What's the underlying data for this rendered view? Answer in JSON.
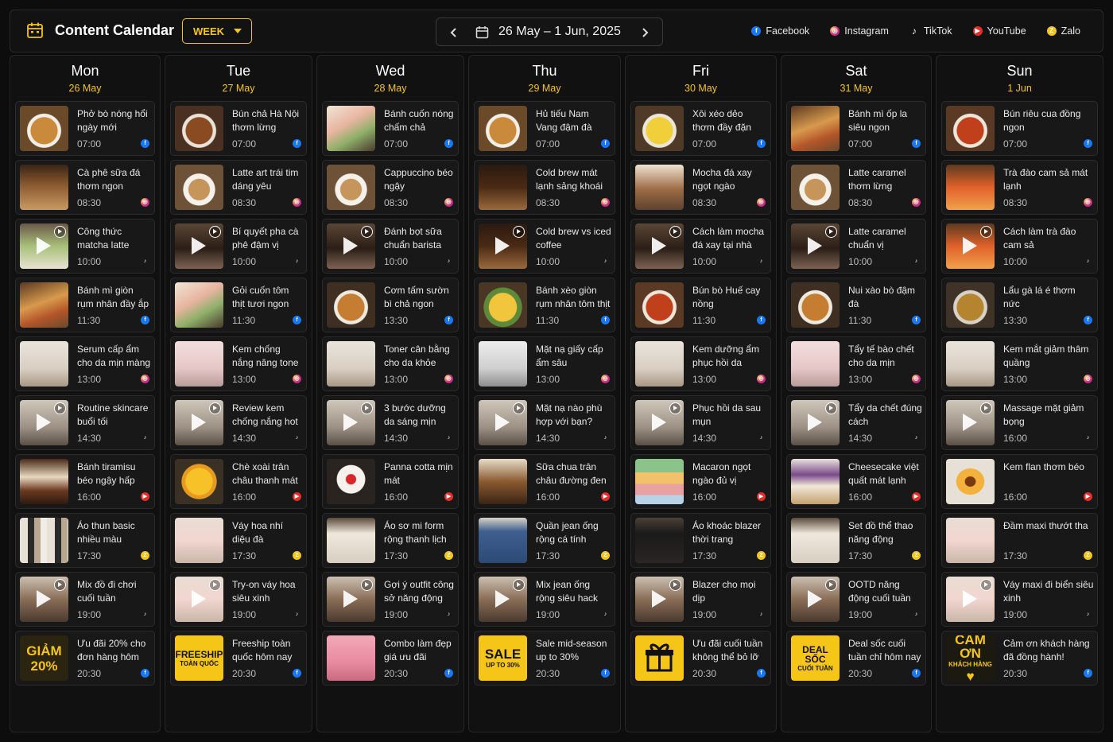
{
  "header": {
    "title": "Content Calendar",
    "view_label": "WEEK",
    "date_range": "26 May – 1 Jun, 2025",
    "prev_icon": "chevron-left-icon",
    "next_icon": "chevron-right-icon"
  },
  "platforms": [
    {
      "key": "fb",
      "label": "Facebook"
    },
    {
      "key": "ig",
      "label": "Instagram"
    },
    {
      "key": "tt",
      "label": "TikTok"
    },
    {
      "key": "yt",
      "label": "YouTube"
    },
    {
      "key": "za",
      "label": "Zalo"
    }
  ],
  "colors": {
    "accent": "#f5c518",
    "facebook": "#1877f2",
    "youtube": "#e52d27",
    "zalo": "#f5c518"
  },
  "days": [
    {
      "day": "Mon",
      "date": "26 May",
      "posts": [
        {
          "title": "Phở bò nóng hổi ngày mới",
          "time": "07:00",
          "platform": "fb",
          "thumb": "pho",
          "video": false
        },
        {
          "title": "Cà phê sữa đá thơm ngon",
          "time": "08:30",
          "platform": "ig",
          "thumb": "icecoffee",
          "video": false
        },
        {
          "title": "Công thức matcha latte chuẩn vị",
          "time": "10:00",
          "platform": "tt",
          "thumb": "matcha",
          "video": true
        },
        {
          "title": "Bánh mì giòn rụm nhân đầy ắp",
          "time": "11:30",
          "platform": "fb",
          "thumb": "banhmi",
          "video": false
        },
        {
          "title": "Serum cấp ẩm cho da mịn màng",
          "time": "13:00",
          "platform": "ig",
          "thumb": "serum",
          "video": false
        },
        {
          "title": "Routine skincare buổi tối",
          "time": "14:30",
          "platform": "tt",
          "thumb": "skincare",
          "video": true
        },
        {
          "title": "Bánh tiramisu béo ngậy hấp dẫn",
          "time": "16:00",
          "platform": "yt",
          "thumb": "dessert",
          "video": false
        },
        {
          "title": "Áo thun basic nhiều màu",
          "time": "17:30",
          "platform": "za",
          "thumb": "clothes",
          "video": false
        },
        {
          "title": "Mix đồ đi chơi cuối tuần",
          "time": "19:00",
          "platform": "tt",
          "thumb": "outfit",
          "video": true
        },
        {
          "title": "Ưu đãi 20% cho đơn hàng hôm nay",
          "time": "20:30",
          "platform": "fb",
          "thumb": "promo",
          "video": false,
          "promo": [
            "GIẢM",
            "20%"
          ],
          "promo_bg": "#2a2410",
          "promo_fg": "#f5c518"
        }
      ]
    },
    {
      "day": "Tue",
      "date": "27 May",
      "posts": [
        {
          "title": "Bún chả Hà Nội thơm lừng",
          "time": "07:00",
          "platform": "fb",
          "thumb": "bun",
          "video": false
        },
        {
          "title": "Latte art trái tim dáng yêu",
          "time": "08:30",
          "platform": "ig",
          "thumb": "latte",
          "video": false
        },
        {
          "title": "Bí quyết pha cà phê đậm vị",
          "time": "10:00",
          "platform": "tt",
          "thumb": "coffee",
          "video": true
        },
        {
          "title": "Gỏi cuốn tôm thịt tươi ngon",
          "time": "11:30",
          "platform": "fb",
          "thumb": "roll",
          "video": false
        },
        {
          "title": "Kem chống nắng nâng tone nhẹ",
          "time": "13:00",
          "platform": "ig",
          "thumb": "cream",
          "video": false
        },
        {
          "title": "Review kem chống nắng hot",
          "time": "14:30",
          "platform": "tt",
          "thumb": "skincare",
          "video": true
        },
        {
          "title": "Chè xoài trân châu thanh mát",
          "time": "16:00",
          "platform": "yt",
          "thumb": "mango",
          "video": false
        },
        {
          "title": "Váy hoa nhí diệu đà",
          "time": "17:30",
          "platform": "za",
          "thumb": "dress",
          "video": false
        },
        {
          "title": "Try-on váy hoa siêu xinh",
          "time": "19:00",
          "platform": "tt",
          "thumb": "dress",
          "video": true
        },
        {
          "title": "Freeship toàn quốc hôm nay",
          "time": "20:30",
          "platform": "fb",
          "thumb": "promo",
          "video": false,
          "promo": [
            "FREESHIP",
            "TOÀN QUỐC"
          ],
          "promo_bg": "#f5c518",
          "promo_fg": "#111"
        }
      ]
    },
    {
      "day": "Wed",
      "date": "28 May",
      "posts": [
        {
          "title": "Bánh cuốn nóng chấm chả",
          "time": "07:00",
          "platform": "fb",
          "thumb": "roll",
          "video": false
        },
        {
          "title": "Cappuccino béo ngậy",
          "time": "08:30",
          "platform": "ig",
          "thumb": "latte",
          "video": false
        },
        {
          "title": "Đánh bọt sữa chuẩn barista",
          "time": "10:00",
          "platform": "tt",
          "thumb": "coffee",
          "video": true
        },
        {
          "title": "Cơm tấm sườn bì chả ngon",
          "time": "13:30",
          "platform": "fb",
          "thumb": "rice",
          "video": false
        },
        {
          "title": "Toner cân bằng cho da khỏe",
          "time": "13:00",
          "platform": "ig",
          "thumb": "serum",
          "video": false
        },
        {
          "title": "3 bước dưỡng da sáng mịn",
          "time": "14:30",
          "platform": "tt",
          "thumb": "skincare",
          "video": true
        },
        {
          "title": "Panna cotta mịn mát",
          "time": "16:00",
          "platform": "yt",
          "thumb": "panna",
          "video": false
        },
        {
          "title": "Áo sơ mi form rộng thanh lịch",
          "time": "17:30",
          "platform": "za",
          "thumb": "shirt",
          "video": false
        },
        {
          "title": "Gợi ý outfit công sở năng động",
          "time": "19:00",
          "platform": "tt",
          "thumb": "outfit",
          "video": true
        },
        {
          "title": "Combo làm đẹp giá ưu đãi",
          "time": "20:30",
          "platform": "fb",
          "thumb": "combo",
          "video": false
        }
      ]
    },
    {
      "day": "Thu",
      "date": "29 May",
      "posts": [
        {
          "title": "Hủ tiếu Nam Vang đậm đà",
          "time": "07:00",
          "platform": "fb",
          "thumb": "pho",
          "video": false
        },
        {
          "title": "Cold brew mát lạnh sảng khoái",
          "time": "08:30",
          "platform": "ig",
          "thumb": "coldbrew",
          "video": false
        },
        {
          "title": "Cold brew vs iced coffee",
          "time": "10:00",
          "platform": "tt",
          "thumb": "coldbrew",
          "video": true
        },
        {
          "title": "Bánh xèo giòn rụm nhân tôm thịt",
          "time": "11:30",
          "platform": "fb",
          "thumb": "banhxeo",
          "video": false
        },
        {
          "title": "Mặt nạ giấy cấp ẩm sâu",
          "time": "13:00",
          "platform": "ig",
          "thumb": "mask",
          "video": false
        },
        {
          "title": "Mặt nạ nào phù hợp với bạn?",
          "time": "14:30",
          "platform": "tt",
          "thumb": "skincare",
          "video": true
        },
        {
          "title": "Sữa chua trân châu đường đen",
          "time": "16:00",
          "platform": "yt",
          "thumb": "yogurt",
          "video": false
        },
        {
          "title": "Quần jean ống rộng cá tính",
          "time": "17:30",
          "platform": "za",
          "thumb": "jeans",
          "video": false
        },
        {
          "title": "Mix jean ống rộng siêu hack dáng",
          "time": "19:00",
          "platform": "tt",
          "thumb": "outfit",
          "video": true
        },
        {
          "title": "Sale mid-season up to 30%",
          "time": "20:30",
          "platform": "fb",
          "thumb": "promo",
          "video": false,
          "promo": [
            "SALE",
            "UP TO 30%"
          ],
          "promo_bg": "#f5c518",
          "promo_fg": "#111"
        }
      ]
    },
    {
      "day": "Fri",
      "date": "30 May",
      "posts": [
        {
          "title": "Xôi xéo dẻo thơm đầy đặn",
          "time": "07:00",
          "platform": "fb",
          "thumb": "xoi",
          "video": false
        },
        {
          "title": "Mocha đá xay ngọt ngào",
          "time": "08:30",
          "platform": "ig",
          "thumb": "mocha",
          "video": false
        },
        {
          "title": "Cách làm mocha đá xay tại nhà",
          "time": "10:00",
          "platform": "tt",
          "thumb": "coffee",
          "video": true
        },
        {
          "title": "Bún bò Huế cay nồng",
          "time": "11:30",
          "platform": "fb",
          "thumb": "bunbo",
          "video": false
        },
        {
          "title": "Kem dưỡng ẩm phục hồi da",
          "time": "13:00",
          "platform": "ig",
          "thumb": "serum",
          "video": false
        },
        {
          "title": "Phục hồi da sau mụn",
          "time": "14:30",
          "platform": "tt",
          "thumb": "skincare",
          "video": true
        },
        {
          "title": "Macaron ngọt ngào đủ vị",
          "time": "16:00",
          "platform": "yt",
          "thumb": "macaron",
          "video": false
        },
        {
          "title": "Áo khoác blazer thời trang",
          "time": "17:30",
          "platform": "za",
          "thumb": "blazer",
          "video": false
        },
        {
          "title": "Blazer cho mọi dịp",
          "time": "19:00",
          "platform": "tt",
          "thumb": "outfit",
          "video": true
        },
        {
          "title": "Ưu đãi cuối tuần không thể bỏ lỡ",
          "time": "20:30",
          "platform": "fb",
          "thumb": "gift",
          "video": false
        }
      ]
    },
    {
      "day": "Sat",
      "date": "31 May",
      "posts": [
        {
          "title": "Bánh mì ốp la siêu ngon",
          "time": "07:00",
          "platform": "fb",
          "thumb": "banhmi",
          "video": false
        },
        {
          "title": "Latte caramel thơm lừng",
          "time": "08:30",
          "platform": "ig",
          "thumb": "latte",
          "video": false
        },
        {
          "title": "Latte caramel chuẩn vị",
          "time": "10:00",
          "platform": "tt",
          "thumb": "coffee",
          "video": true
        },
        {
          "title": "Nui xào bò đậm đà",
          "time": "11:30",
          "platform": "fb",
          "thumb": "rice",
          "video": false
        },
        {
          "title": "Tẩy tế bào chết cho da mịn",
          "time": "13:00",
          "platform": "ig",
          "thumb": "cream",
          "video": false
        },
        {
          "title": "Tẩy da chết đúng cách",
          "time": "14:30",
          "platform": "tt",
          "thumb": "skincare",
          "video": true
        },
        {
          "title": "Cheesecake việt quất mát lạnh",
          "time": "16:00",
          "platform": "yt",
          "thumb": "cheesecake",
          "video": false
        },
        {
          "title": "Set đồ thể thao năng động",
          "time": "17:30",
          "platform": "za",
          "thumb": "shirt",
          "video": false
        },
        {
          "title": "OOTD năng động cuối tuần",
          "time": "19:00",
          "platform": "tt",
          "thumb": "outfit",
          "video": true
        },
        {
          "title": "Deal sốc cuối tuần chỉ hôm nay",
          "time": "20:30",
          "platform": "fb",
          "thumb": "promo",
          "video": false,
          "promo": [
            "DEAL SỐC",
            "CUỐI TUẦN"
          ],
          "promo_bg": "#f5c518",
          "promo_fg": "#111"
        }
      ]
    },
    {
      "day": "Sun",
      "date": "1 Jun",
      "posts": [
        {
          "title": "Bún riêu cua đồng ngon",
          "time": "07:00",
          "platform": "fb",
          "thumb": "bunbo",
          "video": false
        },
        {
          "title": "Trà đào cam sả mát lạnh",
          "time": "08:30",
          "platform": "ig",
          "thumb": "tea",
          "video": false
        },
        {
          "title": "Cách làm trà đào cam sả",
          "time": "10:00",
          "platform": "tt",
          "thumb": "tea",
          "video": true
        },
        {
          "title": "Lẩu gà lá é thơm nức",
          "time": "13:30",
          "platform": "fb",
          "thumb": "hotpot",
          "video": false
        },
        {
          "title": "Kem mắt giảm thâm quầng",
          "time": "13:00",
          "platform": "ig",
          "thumb": "serum",
          "video": false
        },
        {
          "title": "Massage mặt giảm bọng",
          "time": "16:00",
          "platform": "tt",
          "thumb": "skincare",
          "video": true
        },
        {
          "title": "Kem flan thơm béo",
          "time": "16:00",
          "platform": "yt",
          "thumb": "flan",
          "video": false
        },
        {
          "title": "Đầm maxi thướt tha",
          "time": "17:30",
          "platform": "za",
          "thumb": "dress",
          "video": false
        },
        {
          "title": "Váy maxi đi biển siêu xinh",
          "time": "19:00",
          "platform": "tt",
          "thumb": "dress",
          "video": true
        },
        {
          "title": "Cảm ơn khách hàng đã đồng hành!",
          "time": "20:30",
          "platform": "fb",
          "thumb": "promo",
          "video": false,
          "promo": [
            "CẢM ƠN",
            "KHÁCH HÀNG",
            "♥"
          ],
          "promo_bg": "#1c1a10",
          "promo_fg": "#f5c518"
        }
      ]
    }
  ]
}
